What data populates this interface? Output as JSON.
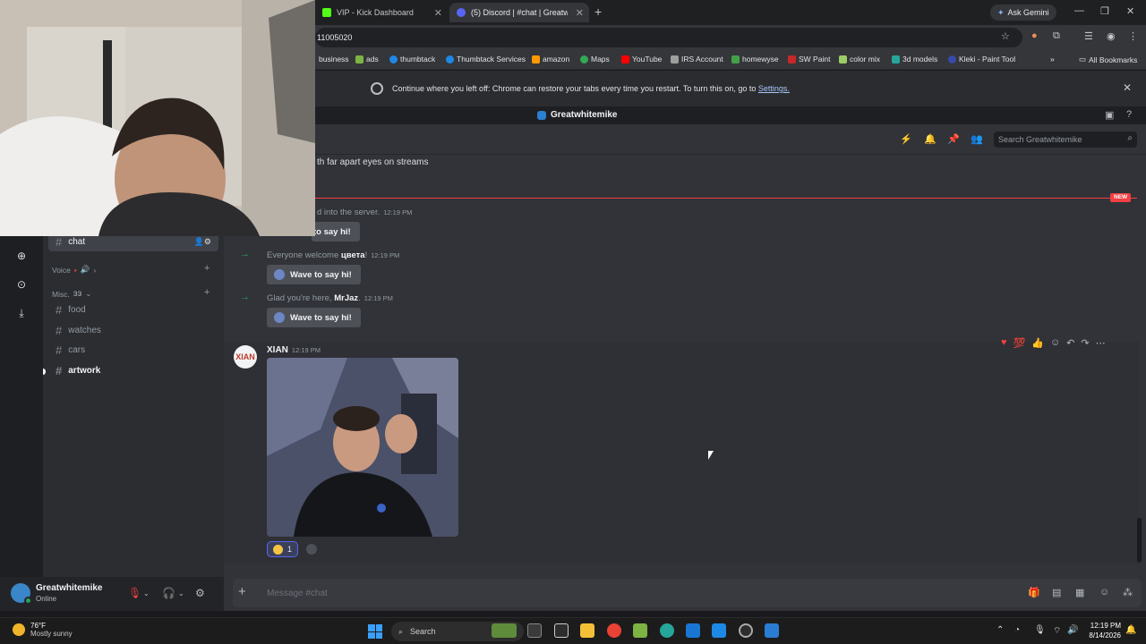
{
  "browser": {
    "tabs": [
      {
        "label": "VIP - Kick Dashboard",
        "color": "#53fc18"
      },
      {
        "label": "(5) Discord | #chat | Greatwhite",
        "color": "#5865f2"
      }
    ],
    "ask_gemini": "Ask Gemini",
    "address": "11005020",
    "bookmarks": [
      "business",
      "ads",
      "thumbtack",
      "Thumbtack Services",
      "amazon",
      "Maps",
      "YouTube",
      "IRS Account",
      "homewyse",
      "SW Paint",
      "color mix",
      "3d models",
      "Kleki - Paint Tool"
    ],
    "all_bookmarks": "All Bookmarks",
    "restore_message": "Continue where you left off: Chrome can restore your tabs every time you restart. To turn this on, go to",
    "restore_link": "Settings."
  },
  "discord": {
    "server_name": "Greatwhitemike",
    "search_placeholder": "Search Greatwhitemike",
    "channels": {
      "current": "chat",
      "voice_category": "Voice",
      "misc_category": "Misc.",
      "misc_items": [
        "food",
        "watches",
        "cars",
        "artwork"
      ]
    },
    "user": {
      "name": "Greatwhitemike",
      "status": "Online"
    },
    "messages": {
      "partial_top": "th far apart eyes on streams",
      "new_label": "NEW",
      "join1_text": "d into the server.",
      "join1_time": "12:19 PM",
      "join2_prefix": "Everyone welcome",
      "join2_name": "цвета",
      "join2_suffix": "!",
      "join2_time": "12:19 PM",
      "join3_prefix": "Glad you're here,",
      "join3_name": "MrJaz",
      "join3_suffix": ".",
      "join3_time": "12:19 PM",
      "wave_label": "Wave to say hi!",
      "wave_partial": "to say hi!",
      "author": "XIAN",
      "author_time": "12:19 PM",
      "avatar_text": "XIAN",
      "reaction_count": "1"
    },
    "composer_placeholder": "Message #chat"
  },
  "taskbar": {
    "temp": "76°F",
    "weather": "Mostly sunny",
    "search": "Search",
    "time": "12:19 PM",
    "date": "8/14/2026"
  }
}
